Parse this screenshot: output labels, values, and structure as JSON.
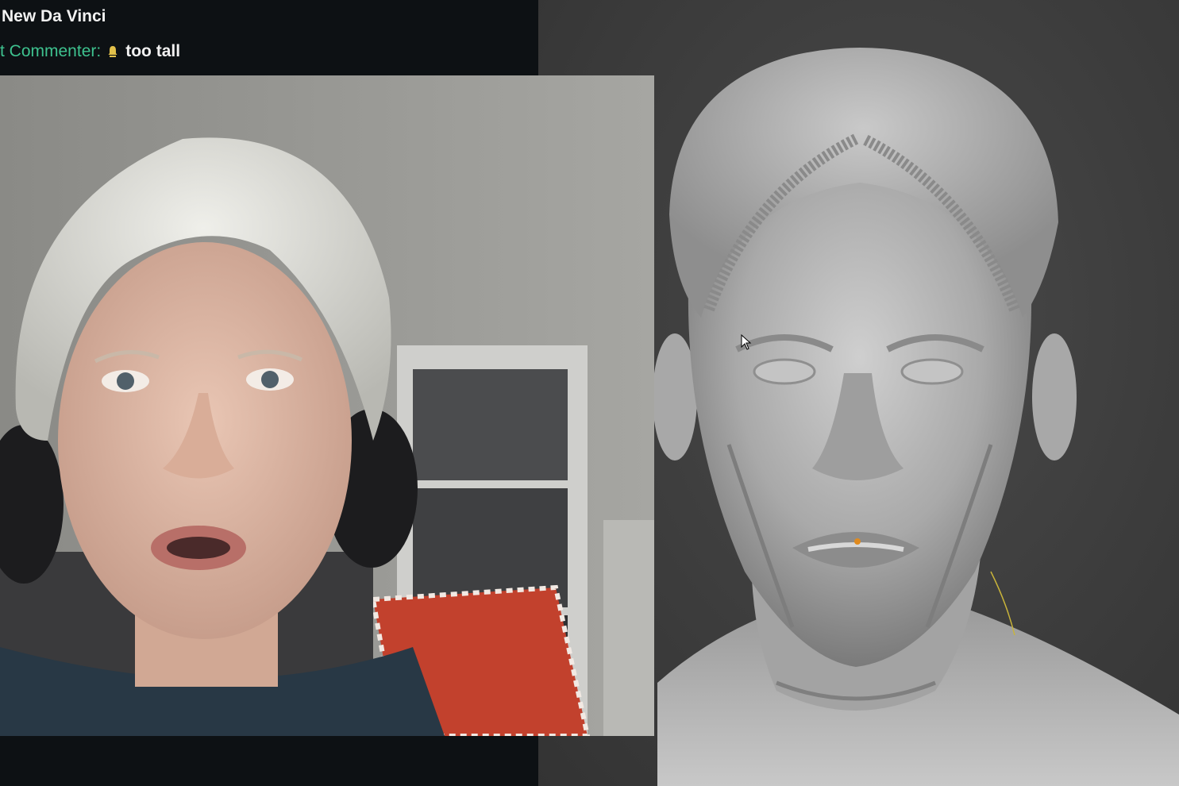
{
  "overlay": {
    "title": "New Da Vinci",
    "chat": {
      "username": "t Commenter",
      "separator": ":",
      "badge_icon": "bell-icon",
      "message": "too tall"
    }
  },
  "webcam": {
    "label": "streamer webcam feed"
  },
  "viewport": {
    "subject": "sculpted head model",
    "background_color": "#404040",
    "model_color": "#b9b9b9"
  },
  "colors": {
    "overlay_bg": "#0d1114",
    "username": "#3ec28f",
    "message_text": "#f2f2f2"
  }
}
